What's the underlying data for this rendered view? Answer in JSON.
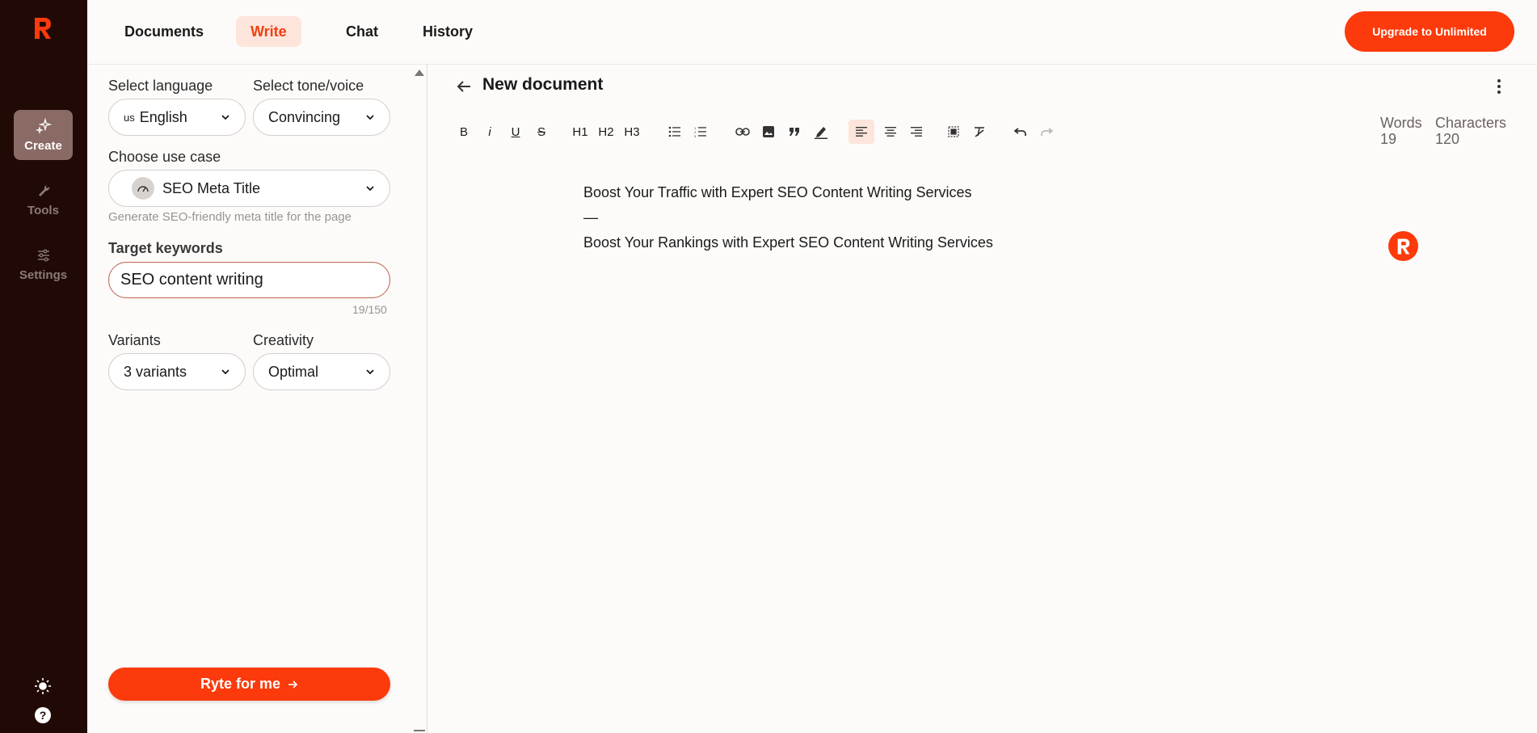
{
  "rail": {
    "items": [
      {
        "label": "Create",
        "icon": "sparkles-icon",
        "active": true
      },
      {
        "label": "Tools",
        "icon": "wrench-icon",
        "active": false
      },
      {
        "label": "Settings",
        "icon": "sliders-icon",
        "active": false
      }
    ],
    "bottom_icons": [
      "sun-icon",
      "help-icon"
    ]
  },
  "nav": {
    "tabs": [
      "Documents",
      "Write",
      "Chat",
      "History"
    ],
    "active_tab": "Write",
    "upgrade_label": "Upgrade to Unlimited"
  },
  "panel": {
    "language_label": "Select language",
    "language_flag": "us",
    "language_value": "English",
    "tone_label": "Select tone/voice",
    "tone_value": "Convincing",
    "usecase_label": "Choose use case",
    "usecase_value": "SEO Meta Title",
    "usecase_hint": "Generate SEO-friendly meta title for the page",
    "keywords_label": "Target keywords",
    "keywords_value": "SEO content writing",
    "keywords_counter": "19/150",
    "variants_label": "Variants",
    "variants_value": "3 variants",
    "creativity_label": "Creativity",
    "creativity_value": "Optimal",
    "submit_label": "Ryte for me"
  },
  "editor": {
    "title": "New document",
    "toolbar": {
      "bold": "B",
      "italic": "i",
      "underline": "U",
      "strike": "S",
      "h1": "H1",
      "h2": "H2",
      "h3": "H3"
    },
    "stats": {
      "words_label": "Words",
      "words_value": "19",
      "chars_label": "Characters",
      "chars_value": "120"
    },
    "lines": [
      "Boost Your Traffic with Expert SEO Content Writing Services",
      "—",
      "Boost Your Rankings with Expert SEO Content Writing Services"
    ]
  },
  "colors": {
    "accent": "#fc3a0b",
    "rail_bg": "#210a06",
    "active_tab_bg": "#fde5dc"
  }
}
